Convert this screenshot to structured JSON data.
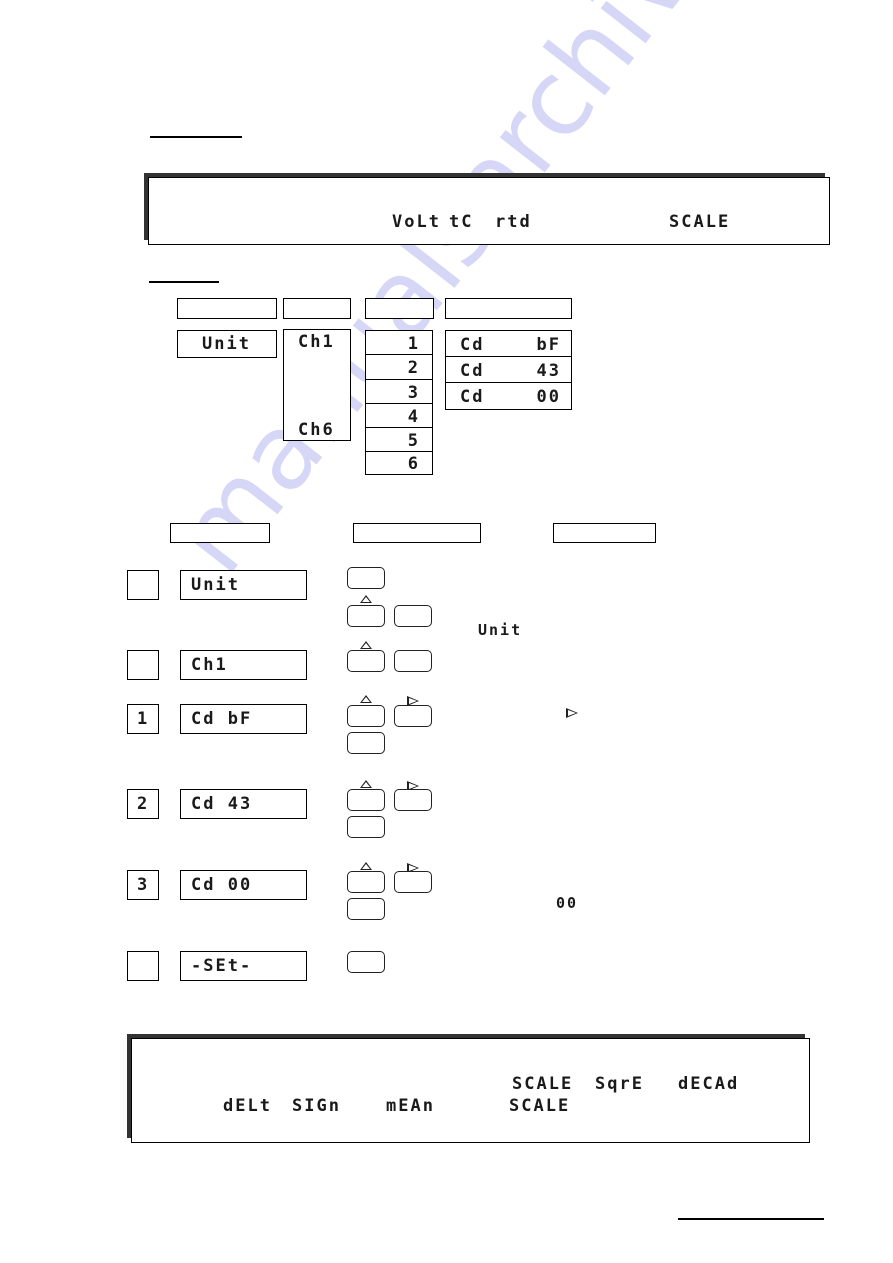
{
  "watermark": "manualsarchive.com",
  "note_box_top": {
    "segment_words": [
      "VoLt",
      "tC",
      "rtd",
      "SCALE"
    ]
  },
  "structure": {
    "column_headers": [
      "",
      "",
      "",
      ""
    ],
    "unit": "Unit",
    "channels": [
      "Ch1",
      "Ch6"
    ],
    "positions": [
      "1",
      "2",
      "3",
      "4",
      "5",
      "6"
    ],
    "codes": [
      {
        "prefix": "Cd",
        "value": "bF"
      },
      {
        "prefix": "Cd",
        "value": "43"
      },
      {
        "prefix": "Cd",
        "value": "00"
      }
    ]
  },
  "procedure": {
    "column_headers": [
      "",
      "",
      ""
    ],
    "steps": [
      {
        "step": "",
        "display": "Unit",
        "inline_segment": "Unit"
      },
      {
        "step": "",
        "display": "Ch1"
      },
      {
        "step": "1",
        "display": "Cd bF",
        "inline_glyph": "right-triangle"
      },
      {
        "step": "2",
        "display": "Cd 43"
      },
      {
        "step": "3",
        "display": "Cd 00",
        "inline_segment": "00"
      },
      {
        "step": "",
        "display": "-SEt-"
      }
    ]
  },
  "note_box_bottom": {
    "line1_words": [
      "SCALE",
      "SqrE",
      "dECAd"
    ],
    "line2_words": [
      "dELt",
      "SIGn",
      "mEAn",
      "SCALE"
    ]
  }
}
